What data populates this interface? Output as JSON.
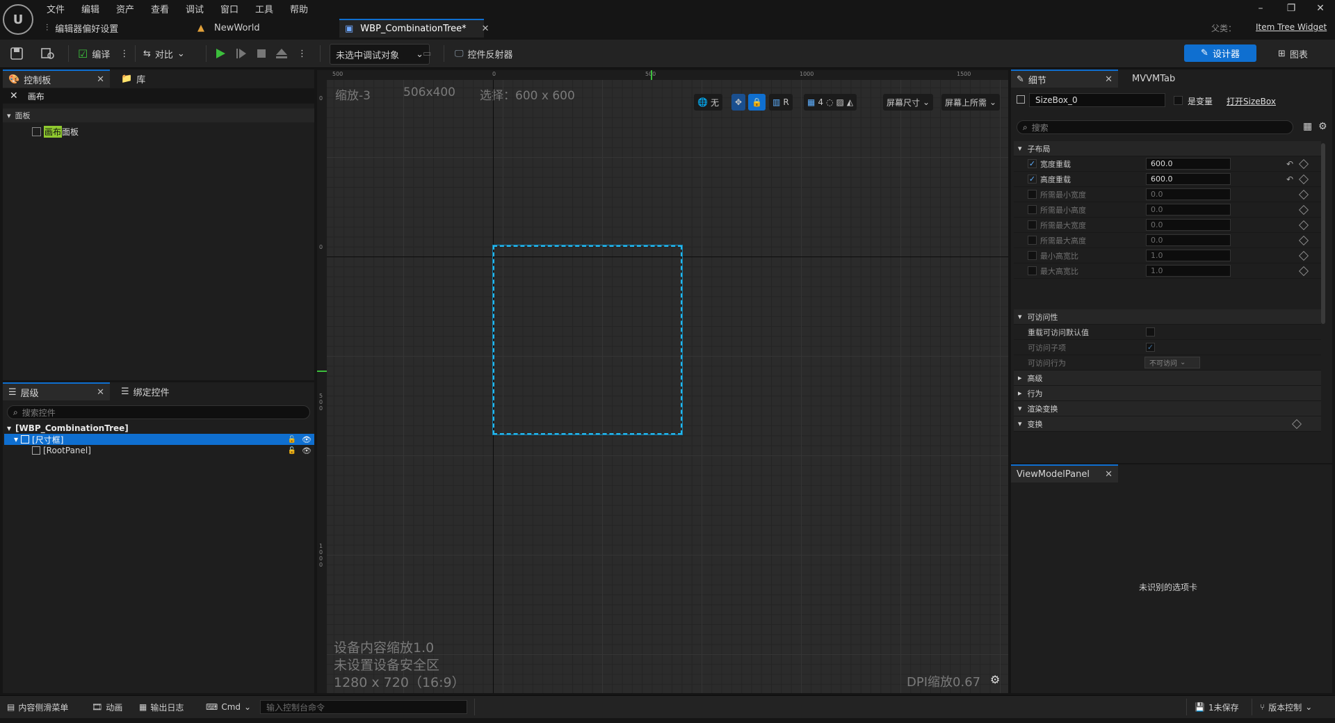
{
  "menu": [
    "文件",
    "编辑",
    "资产",
    "查看",
    "调试",
    "窗口",
    "工具",
    "帮助"
  ],
  "tabs": {
    "editor_prefs": "编辑器偏好设置",
    "world": "NewWorld",
    "widget": "WBP_CombinationTree*"
  },
  "parent": {
    "label": "父类：",
    "value": "Item Tree Widget"
  },
  "window_controls": {
    "minimize": "–",
    "restore": "❐",
    "close": "✕"
  },
  "toolbar": {
    "compile": "编译",
    "diff": "对比",
    "debug_target": "未选中调试对象",
    "widget_reflector": "控件反射器",
    "designer": "设计器",
    "graph": "图表"
  },
  "palette": {
    "tab": "控制板",
    "library_tab": "库",
    "search_value": "画布",
    "category": "面板",
    "item_highlight": "画布",
    "item_rest": "面板"
  },
  "hierarchy": {
    "tab": "层级",
    "bind_tab": "绑定控件",
    "search_placeholder": "搜索控件",
    "root": "[WBP_CombinationTree]",
    "items": [
      "[尺寸框]",
      "[RootPanel]"
    ]
  },
  "viewport": {
    "zoom": "缩放-3",
    "size": "506x400",
    "selection": "选择：600 x 600",
    "device_scale": "设备内容缩放1.0",
    "safe_zone": "未设置设备安全区",
    "resolution": "1280 x 720（16:9）",
    "dpi": "DPI缩放0.67",
    "none_label": "无",
    "r_label": "R",
    "grid_count": "4",
    "screen_size": "屏幕尺寸",
    "screen_fill": "屏幕上所需",
    "ruler_labels": [
      "500",
      "0",
      "500",
      "1000",
      "1500"
    ],
    "ruler_v_labels": [
      "0",
      "0",
      "500",
      "1000"
    ]
  },
  "details": {
    "tab": "细节",
    "mvvm_tab": "MVVMTab",
    "widget_name": "SizeBox_0",
    "is_variable": "是变量",
    "open_link": "打开SizeBox",
    "search_placeholder": "搜索",
    "cat_child_layout": "子布局",
    "props": [
      {
        "label": "宽度重载",
        "value": "600.0",
        "checked": true
      },
      {
        "label": "高度重载",
        "value": "600.0",
        "checked": true
      },
      {
        "label": "所需最小宽度",
        "value": "0.0",
        "checked": false
      },
      {
        "label": "所需最小高度",
        "value": "0.0",
        "checked": false
      },
      {
        "label": "所需最大宽度",
        "value": "0.0",
        "checked": false
      },
      {
        "label": "所需最大高度",
        "value": "0.0",
        "checked": false
      },
      {
        "label": "最小高宽比",
        "value": "1.0",
        "checked": false
      },
      {
        "label": "最大高宽比",
        "value": "1.0",
        "checked": false
      }
    ],
    "cat_accessibility": "可访问性",
    "override_access": "重载可访问默认值",
    "accessible_children": "可访问子项",
    "access_behavior": "可访问行为",
    "access_behavior_value": "不可访问",
    "cat_advanced": "高级",
    "cat_behavior": "行为",
    "cat_render_transform": "渲染变换",
    "cat_transform": "变换"
  },
  "viewmodel": {
    "tab": "ViewModelPanel",
    "message": "未识别的选项卡"
  },
  "bottom": {
    "content_drawer": "内容侧滑菜单",
    "animation": "动画",
    "output_log": "输出日志",
    "cmd": "Cmd",
    "console_placeholder": "输入控制台命令",
    "unsaved": "1未保存",
    "source_control": "版本控制"
  },
  "colors": {
    "accent": "#0f6fd0",
    "selection": "#22b8f0",
    "play": "#3cbf3c"
  }
}
